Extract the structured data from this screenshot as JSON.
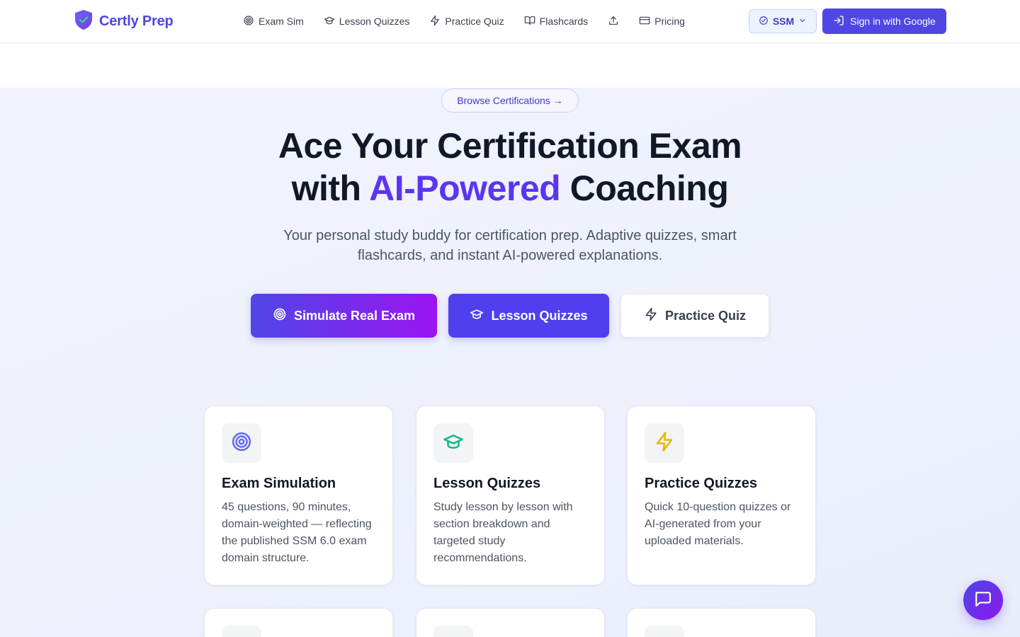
{
  "brand": {
    "name": "Certly Prep",
    "color": "#4f46e5",
    "accent": "#5b35f0"
  },
  "nav": {
    "items": [
      {
        "label": "Exam Sim",
        "icon": "target-icon"
      },
      {
        "label": "Lesson Quizzes",
        "icon": "graduation-cap-icon"
      },
      {
        "label": "Practice Quiz",
        "icon": "lightning-icon"
      },
      {
        "label": "Flashcards",
        "icon": "book-open-icon"
      },
      {
        "label": "",
        "icon": "upload-icon"
      },
      {
        "label": "Pricing",
        "icon": "credit-card-icon"
      }
    ],
    "certification": "SSM",
    "signin": "Sign in with Google"
  },
  "hero": {
    "pill": "Browse Certifications →",
    "headline_line1": "Ace Your Certification Exam",
    "headline_line2_prefix": "with ",
    "headline_line2_accent": "AI-Powered",
    "headline_line2_suffix": " Coaching",
    "subtext": "Your personal study buddy for certification prep. Adaptive quizzes, smart flashcards, and instant AI-powered explanations.",
    "buttons": {
      "exam": "Simulate Real Exam",
      "lessons": "Lesson Quizzes",
      "practice": "Practice Quiz"
    }
  },
  "features": [
    {
      "title": "Exam Simulation",
      "desc": "45 questions, 90 minutes, domain-weighted — reflecting the published SSM 6.0 exam domain structure.",
      "icon": "target-icon",
      "icon_color": "#6366f1"
    },
    {
      "title": "Lesson Quizzes",
      "desc": "Study lesson by lesson with section breakdown and targeted study recommendations.",
      "icon": "graduation-cap-icon",
      "icon_color": "#10b981"
    },
    {
      "title": "Practice Quizzes",
      "desc": "Quick 10-question quizzes or AI-generated from your uploaded materials.",
      "icon": "lightning-icon",
      "icon_color": "#eab308"
    }
  ],
  "chat": {
    "icon": "chat-icon"
  }
}
